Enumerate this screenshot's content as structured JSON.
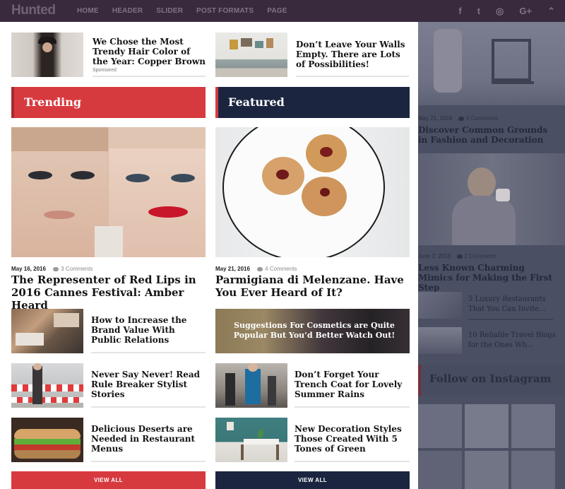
{
  "header": {
    "logo": "Hunted",
    "nav": [
      "HOME",
      "HEADER",
      "SLIDER",
      "POST FORMATS",
      "PAGE"
    ],
    "social_icons": [
      "facebook-icon",
      "twitter-icon",
      "instagram-icon",
      "google-plus-icon",
      "chevron-up-icon"
    ],
    "social_glyphs": [
      "f",
      "t",
      "◎",
      "G+",
      "⌃"
    ]
  },
  "top_posts": [
    {
      "title": "We Chose the Most Trendy Hair Color of the Year: Copper Brown",
      "badge": "Sponsored"
    },
    {
      "title": "Don’t Leave Your Walls Empty. There are Lots of Possibilities!"
    }
  ],
  "trending": {
    "heading": "Trending",
    "color": "#d63a3f",
    "featured": {
      "date": "May 16, 2016",
      "comments": "3 Comments",
      "title": "The Representer of Red Lips in 2016 Cannes Festival: Amber Heard"
    },
    "items": [
      {
        "title": "How to Increase the Brand Value With Public Relations"
      },
      {
        "title": "Never Say Never! Read Rule Breaker Stylist Stories"
      },
      {
        "title": "Delicious Deserts are Needed in Restaurant Menus"
      }
    ],
    "view_all": "VIEW ALL"
  },
  "featured": {
    "heading": "Featured",
    "color": "#1b2540",
    "featured": {
      "date": "May 21, 2016",
      "comments": "4 Comments",
      "title": "Parmigiana di Melenzane. Have You Ever Heard of It?"
    },
    "banner": "Suggestions For Cosmetics are Quite Popular But You’d Better Watch Out!",
    "items": [
      {
        "title": "Don’t Forget Your Trench Coat for Lovely Summer Rains"
      },
      {
        "title": "New Decoration Styles Those Created With 5 Tones of Green"
      }
    ],
    "view_all": "VIEW ALL"
  },
  "sidebar": {
    "post1": {
      "date": "May 21, 2016",
      "comments": "3 Comments",
      "title": "Discover Common Grounds in Fashion and Decoration"
    },
    "post2": {
      "date": "June 2, 2016",
      "comments": "2 Comments",
      "title": "Less Known Charming Mimics for Making the First Step"
    },
    "small_posts": [
      {
        "title": "5 Luxury Restaurants That You Can Invite..."
      },
      {
        "title": "10 Reliable Travel Blogs for the Ones Wh..."
      }
    ],
    "follow_title": "Follow on Instagram"
  }
}
